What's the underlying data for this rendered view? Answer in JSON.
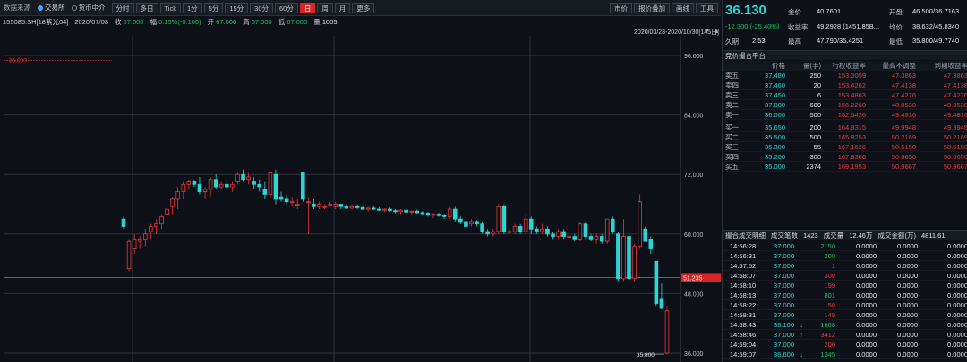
{
  "toolbar": {
    "source_label": "数据来源",
    "src1": "交易所",
    "src2": "货币中介",
    "periods": [
      "分时",
      "多日",
      "Tick",
      "1分",
      "5分",
      "15分",
      "30分",
      "60分",
      "日",
      "周",
      "月",
      "更多"
    ],
    "active_period": "日",
    "right_buttons": [
      "市价",
      "报价叠加",
      "画线",
      "工具"
    ]
  },
  "info": {
    "code": "155085.SH[18紫光04]",
    "date": "2020/07/03",
    "close_label": "收",
    "close": "67.000",
    "chg_label": "幅",
    "chg": "0.15%(-0.100)",
    "open_label": "开",
    "open": "67.000",
    "high_label": "高",
    "high": "67.000",
    "low_label": "低",
    "low": "67.000",
    "vol_label": "量",
    "vol": "1005"
  },
  "date_range": "2020/03/23-2020/10/30[145日]",
  "chart_data": {
    "type": "candlestick",
    "ylim": [
      36,
      96
    ],
    "yticks": [
      {
        "v": 96,
        "l": "96.000"
      },
      {
        "v": 84,
        "l": "84.000"
      },
      {
        "v": 72,
        "l": "72.000"
      },
      {
        "v": 60,
        "l": "60.000"
      },
      {
        "v": 48,
        "l": "48.000"
      },
      {
        "v": 36,
        "l": "36.000"
      }
    ],
    "last_price": {
      "v": 51.235,
      "l": "51.235"
    },
    "max_label": {
      "v": 95,
      "l": "35.000"
    },
    "min_label": {
      "v": 35.8,
      "l": "35.800"
    },
    "candles": [
      [
        63,
        63.5,
        61,
        61.5
      ],
      [
        53,
        59,
        52.5,
        58.5
      ],
      [
        57,
        60,
        56,
        59
      ],
      [
        58.5,
        59.5,
        57,
        59
      ],
      [
        59,
        61,
        57.5,
        60
      ],
      [
        60.5,
        62,
        59,
        61.5
      ],
      [
        61.5,
        63,
        60,
        62
      ],
      [
        62,
        64,
        61,
        63.5
      ],
      [
        64,
        65.5,
        63,
        65
      ],
      [
        65.5,
        67.5,
        64,
        67
      ],
      [
        67,
        69.5,
        65,
        68.5
      ],
      [
        68.5,
        70.5,
        67,
        70
      ],
      [
        70,
        71,
        69,
        70.5
      ],
      [
        70.5,
        71,
        69.5,
        70
      ],
      [
        70,
        71.5,
        68,
        68.5
      ],
      [
        68.5,
        69.5,
        67,
        69
      ],
      [
        69,
        71.5,
        67.5,
        71
      ],
      [
        71,
        72,
        69,
        69.5
      ],
      [
        69.5,
        70.5,
        69,
        70
      ],
      [
        70,
        71,
        69,
        69.5
      ],
      [
        69.5,
        70.5,
        68.5,
        70
      ],
      [
        70.5,
        72.5,
        70,
        72
      ],
      [
        72,
        73,
        70.5,
        71
      ],
      [
        71,
        72.5,
        70,
        71.5
      ],
      [
        70.5,
        71.5,
        69,
        70
      ],
      [
        70,
        71,
        68.5,
        69.5
      ],
      [
        69,
        70.5,
        67,
        68
      ],
      [
        68,
        72.5,
        67.5,
        72.5
      ],
      [
        72,
        73,
        66,
        67
      ],
      [
        67.5,
        68.5,
        66.5,
        67
      ],
      [
        67,
        68,
        66,
        66.5
      ],
      [
        66.5,
        67.5,
        65.5,
        66.5
      ],
      [
        66,
        67,
        65,
        66
      ],
      [
        72.5,
        72.5,
        66.5,
        67
      ],
      [
        66.5,
        67.5,
        60,
        66.5
      ],
      [
        66,
        67,
        65,
        65.5
      ],
      [
        65.5,
        66.5,
        65,
        66
      ],
      [
        65.5,
        66,
        65,
        65.5
      ],
      [
        66,
        66.5,
        65.5,
        66
      ],
      [
        65.5,
        66.5,
        65,
        66
      ],
      [
        66,
        66,
        65,
        65.5
      ],
      [
        65.5,
        66,
        65,
        65.2
      ],
      [
        65.2,
        66,
        65,
        65.5
      ],
      [
        65.5,
        66,
        65,
        65.3
      ],
      [
        65.3,
        65.8,
        64.8,
        65
      ],
      [
        65,
        65.5,
        64.5,
        65.2
      ],
      [
        65.2,
        65.6,
        64.8,
        65
      ],
      [
        65,
        65.4,
        64.6,
        64.8
      ],
      [
        64.8,
        65.2,
        64.4,
        65
      ],
      [
        65,
        65.3,
        64.5,
        64.7
      ],
      [
        64.7,
        65,
        64.2,
        64.5
      ],
      [
        64.5,
        65,
        64,
        64.8
      ],
      [
        64.8,
        65,
        64.2,
        64.4
      ],
      [
        64.4,
        64.8,
        64,
        64.6
      ],
      [
        64.6,
        64.9,
        64.1,
        64.3
      ],
      [
        64.3,
        64.6,
        63.8,
        64.2
      ],
      [
        64.2,
        64.5,
        63.5,
        63.8
      ],
      [
        63.8,
        64.2,
        63.2,
        64
      ],
      [
        64,
        64.3,
        63.5,
        63.7
      ],
      [
        63.7,
        64,
        63,
        63.5
      ],
      [
        63.5,
        65.5,
        63,
        65
      ],
      [
        65,
        65.5,
        62.5,
        63
      ],
      [
        63,
        63.5,
        62,
        62.5
      ],
      [
        62.5,
        63,
        61,
        61.5
      ],
      [
        62,
        63,
        61.5,
        62.5
      ],
      [
        62.5,
        62.8,
        61.5,
        62
      ],
      [
        62,
        62.5,
        60,
        60.5
      ],
      [
        60.5,
        61,
        59.5,
        60
      ],
      [
        60,
        61,
        59.5,
        60.5
      ],
      [
        60.5,
        66,
        60,
        65.5
      ],
      [
        65.5,
        66,
        60,
        60.5
      ],
      [
        60.5,
        61,
        60,
        60.5
      ],
      [
        60.5,
        62,
        60,
        61.5
      ],
      [
        61.5,
        62,
        60,
        60.5
      ],
      [
        60.5,
        64,
        60,
        63
      ],
      [
        63,
        63.5,
        60,
        61
      ],
      [
        61,
        61.5,
        60,
        60.5
      ],
      [
        60.5,
        62,
        60,
        61
      ],
      [
        61,
        61.5,
        59.5,
        60
      ],
      [
        60,
        60.5,
        59,
        59.5
      ],
      [
        59.5,
        61,
        59,
        60.5
      ],
      [
        60.5,
        61,
        59,
        59.5
      ],
      [
        59.5,
        60,
        59,
        59.5
      ],
      [
        59.5,
        60,
        58.5,
        59
      ],
      [
        59,
        62.5,
        58.5,
        62
      ],
      [
        62,
        62.5,
        59,
        59.5
      ],
      [
        59.5,
        60,
        58.5,
        59
      ],
      [
        59,
        60,
        58,
        59.5
      ],
      [
        59.5,
        60,
        58,
        58.5
      ],
      [
        58.5,
        63,
        58,
        63
      ],
      [
        63,
        63.5,
        60,
        60.5
      ],
      [
        60,
        60.5,
        50.5,
        51
      ],
      [
        51,
        63,
        50.5,
        59.5
      ],
      [
        59.5,
        59.5,
        50.5,
        51
      ],
      [
        51,
        58,
        50.5,
        57.5
      ],
      [
        57.5,
        68,
        57,
        66.5
      ],
      [
        61,
        61.5,
        58.5,
        58.5
      ],
      [
        59,
        59.5,
        56,
        57
      ],
      [
        54.5,
        54.5,
        45.5,
        46
      ],
      [
        47,
        50,
        45,
        45
      ],
      [
        36,
        45.5,
        35.8,
        44.5
      ]
    ]
  },
  "quote": {
    "price": "36.130",
    "change": "-12.300 (-25.40%)",
    "jing_label": "金价",
    "jing": "40.7601",
    "kai_label": "开盘",
    "kai": "46.500/36.7163",
    "yld_label": "收益率",
    "yld": "49.2928 (1451.85B...",
    "jun_label": "均价",
    "jun": "38.632/45.8340",
    "dur_label": "久期",
    "dur": "2.53",
    "zg_label": "最高",
    "zg": "47.790/35.4251",
    "zd_label": "最低",
    "zd": "35.800/49.7740"
  },
  "book": {
    "title": "竞价撮合平台",
    "headers": [
      "",
      "价格",
      "量(手)",
      "行权收益率",
      "最高不调整",
      "到期收益率"
    ],
    "asks": [
      [
        "卖五",
        "37.480",
        "250",
        "153.3059",
        "47.3863",
        "47.3863"
      ],
      [
        "卖四",
        "37.460",
        "20",
        "153.4262",
        "47.4138",
        "47.4138"
      ],
      [
        "卖三",
        "37.450",
        "6",
        "153.4863",
        "47.4276",
        "47.4276"
      ],
      [
        "卖二",
        "37.000",
        "600",
        "156.2260",
        "48.0530",
        "48.0530"
      ],
      [
        "卖一",
        "36.000",
        "500",
        "162.5426",
        "49.4816",
        "49.4816"
      ]
    ],
    "bids": [
      [
        "买一",
        "35.650",
        "200",
        "164.8315",
        "49.9948",
        "49.9948"
      ],
      [
        "买二",
        "35.500",
        "500",
        "165.8253",
        "50.2169",
        "50.2169"
      ],
      [
        "买三",
        "35.300",
        "55",
        "167.1626",
        "50.5150",
        "50.5150"
      ],
      [
        "买四",
        "35.200",
        "300",
        "167.8366",
        "50.6650",
        "50.6650"
      ],
      [
        "买五",
        "35.000",
        "2374",
        "169.1953",
        "50.9667",
        "50.9667"
      ]
    ]
  },
  "trades": {
    "title": "撮合成交明细",
    "count_label": "成交笔数",
    "count": "1423",
    "amt_label": "成交量",
    "amt": "12.46万",
    "val_label": "成交金额(万)",
    "val": "4811.61",
    "rows": [
      [
        "14:56:28",
        "37.000",
        "",
        "2150",
        "g",
        "0.0000",
        "0.0000",
        "0.0000"
      ],
      [
        "14:56:31",
        "37.000",
        "",
        "200",
        "g",
        "0.0000",
        "0.0000",
        "0.0000"
      ],
      [
        "14:57:52",
        "37.000",
        "",
        "1",
        "r",
        "0.0000",
        "0.0000",
        "0.0000"
      ],
      [
        "14:58:07",
        "37.000",
        "",
        "300",
        "r",
        "0.0000",
        "0.0000",
        "0.0000"
      ],
      [
        "14:58:10",
        "37.000",
        "",
        "199",
        "r",
        "0.0000",
        "0.0000",
        "0.0000"
      ],
      [
        "14:58:13",
        "37.000",
        "",
        "801",
        "g",
        "0.0000",
        "0.0000",
        "0.0000"
      ],
      [
        "14:58:22",
        "37.000",
        "",
        "50",
        "r",
        "0.0000",
        "0.0000",
        "0.0000"
      ],
      [
        "14:58:31",
        "37.000",
        "",
        "149",
        "r",
        "0.0000",
        "0.0000",
        "0.0000"
      ],
      [
        "14:58:43",
        "36.100",
        "↓",
        "1668",
        "g",
        "0.0000",
        "0.0000",
        "0.0000"
      ],
      [
        "14:58:46",
        "37.000",
        "↑",
        "3412",
        "r",
        "0.0000",
        "0.0000",
        "0.0000"
      ],
      [
        "14:59:04",
        "37.000",
        "",
        "200",
        "r",
        "0.0000",
        "0.0000",
        "0.0000"
      ],
      [
        "14:59:07",
        "36.600",
        "↓",
        "1345",
        "g",
        "0.0000",
        "0.0000",
        "0.0000"
      ],
      [
        "14:59:16",
        "36.000",
        "↓",
        "100",
        "r",
        "0.0000",
        "0.0000",
        "0.0000"
      ]
    ]
  },
  "colors": {
    "up": "#e5383b",
    "down": "#2cd5d5",
    "accent": "#d62728"
  }
}
